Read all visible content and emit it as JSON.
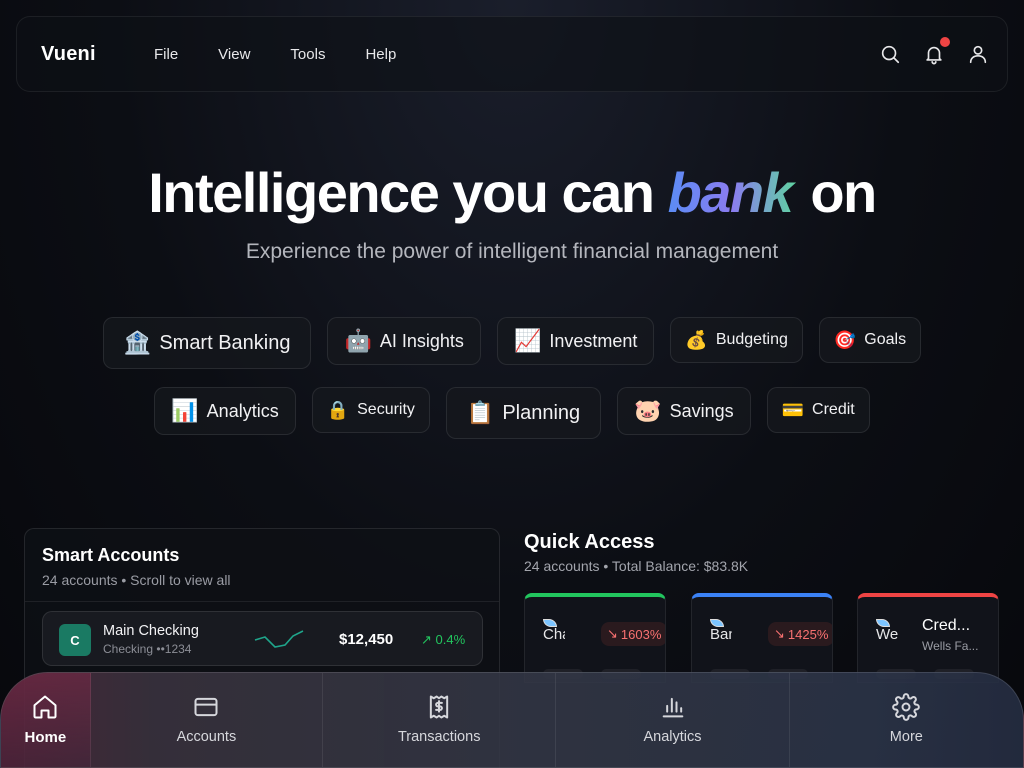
{
  "header": {
    "logo": "Vueni",
    "menu": [
      "File",
      "View",
      "Tools",
      "Help"
    ]
  },
  "hero": {
    "title_before": "Intelligence you can ",
    "title_accent": "bank",
    "title_after": " on",
    "subtitle": "Experience the power of intelligent financial management"
  },
  "pills_row1": [
    {
      "emoji": "🏦",
      "label": "Smart Banking"
    },
    {
      "emoji": "🤖",
      "label": "AI Insights"
    },
    {
      "emoji": "📈",
      "label": "Investment"
    },
    {
      "emoji": "💰",
      "label": "Budgeting"
    },
    {
      "emoji": "🎯",
      "label": "Goals"
    }
  ],
  "pills_row2": [
    {
      "emoji": "📊",
      "label": "Analytics"
    },
    {
      "emoji": "🔒",
      "label": "Security"
    },
    {
      "emoji": "📋",
      "label": "Planning"
    },
    {
      "emoji": "🐷",
      "label": "Savings"
    },
    {
      "emoji": "💳",
      "label": "Credit"
    }
  ],
  "smart_accounts": {
    "title": "Smart Accounts",
    "subtitle": "24 accounts • Scroll to view all",
    "rows": [
      {
        "badge": "C",
        "name": "Main Checking",
        "meta": "Checking ••1234",
        "amount": "$12,450",
        "change": "0.4%"
      }
    ]
  },
  "quick_access": {
    "title": "Quick Access",
    "subtitle": "24 accounts • Total Balance: $83.8K",
    "cards": [
      {
        "logo_text": "Cha",
        "badge": "1603%"
      },
      {
        "logo_text": "Ban",
        "badge": "1425%"
      },
      {
        "logo_text": "Wel",
        "name": "Cred...",
        "bank": "Wells Fa..."
      }
    ]
  },
  "bottom_nav": [
    {
      "label": "Home"
    },
    {
      "label": "Accounts"
    },
    {
      "label": "Transactions"
    },
    {
      "label": "Analytics"
    },
    {
      "label": "More"
    }
  ]
}
